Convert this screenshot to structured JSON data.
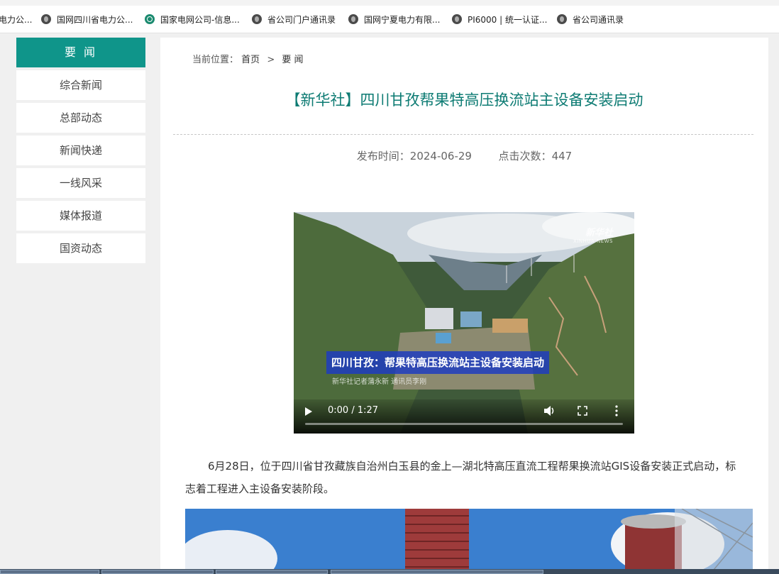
{
  "browser": {
    "bookmarks": [
      {
        "label": "电力公...",
        "icon": "globe-icon"
      },
      {
        "label": "国网四川省电力公...",
        "icon": "globe-icon"
      },
      {
        "label": "国家电网公司-信息...",
        "icon": "sgcc-logo-icon"
      },
      {
        "label": "省公司门户通讯录",
        "icon": "globe-icon"
      },
      {
        "label": "国网宁夏电力有限...",
        "icon": "globe-icon"
      },
      {
        "label": "PI6000 | 统一认证...",
        "icon": "globe-icon"
      },
      {
        "label": "省公司通讯录",
        "icon": "globe-icon"
      }
    ]
  },
  "sidebar": {
    "header": "要 闻",
    "items": [
      {
        "label": "综合新闻"
      },
      {
        "label": "总部动态"
      },
      {
        "label": "新闻快递"
      },
      {
        "label": "一线风采"
      },
      {
        "label": "媒体报道"
      },
      {
        "label": "国资动态"
      }
    ]
  },
  "breadcrumb": {
    "prefix": "当前位置：",
    "home": "首页",
    "separator": ">",
    "current": "要 闻"
  },
  "article": {
    "title": "【新华社】四川甘孜帮果特高压换流站主设备安装启动",
    "publish_label": "发布时间：",
    "publish_date": "2024-06-29",
    "clicks_label": "点击次数：",
    "clicks": "447",
    "paragraph": "6月28日，位于四川省甘孜藏族自治州白玉县的金上—湖北特高压直流工程帮果换流站GIS设备安装正式启动，标志着工程进入主设备安装阶段。"
  },
  "video": {
    "caption": "四川甘孜：帮果特高压换流站主设备安装启动",
    "subcaption": "新华社记者蒲永新 通讯员李刚",
    "logo_cn": "新华社",
    "logo_en": "XINHUA NEWS",
    "time": "0:00 / 1:27",
    "progress": 0
  },
  "colors": {
    "accent": "#0f958a",
    "title": "#0d7b73",
    "caption_bg": "#1e3cbe"
  }
}
